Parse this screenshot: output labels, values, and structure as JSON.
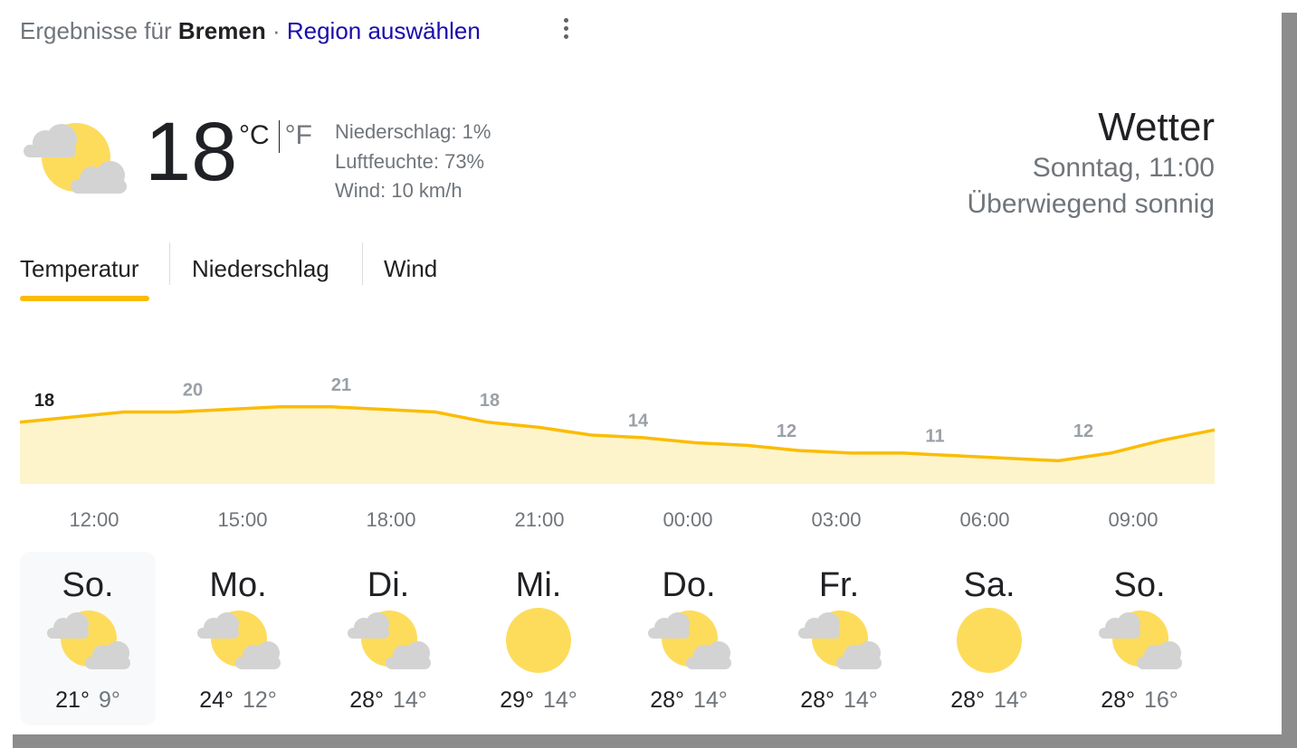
{
  "header": {
    "prefix": "Ergebnisse für",
    "location": "Bremen",
    "separator": "·",
    "region_link": "Region auswählen"
  },
  "current": {
    "icon": "partly-cloudy-icon",
    "temperature": "18",
    "unit_c": "°C",
    "unit_f": "°F",
    "precipitation": "Niederschlag: 1%",
    "humidity": "Luftfeuchte: 73%",
    "wind": "Wind: 10 km/h"
  },
  "summary": {
    "title": "Wetter",
    "datetime": "Sonntag, 11:00",
    "condition": "Überwiegend sonnig"
  },
  "tabs": [
    {
      "label": "Temperatur",
      "active": true
    },
    {
      "label": "Niederschlag",
      "active": false
    },
    {
      "label": "Wind",
      "active": false
    }
  ],
  "colors": {
    "accent": "#fbbc04",
    "area_fill": "#fdf4cc",
    "link": "#1a0dab",
    "muted": "#70757a",
    "sun": "#fddc5c",
    "cloud": "#d3d3d3"
  },
  "chart_data": {
    "type": "area",
    "categories": [
      "12:00",
      "15:00",
      "18:00",
      "21:00",
      "00:00",
      "03:00",
      "06:00",
      "09:00"
    ],
    "labels": [
      "18",
      "20",
      "21",
      "18",
      "14",
      "12",
      "11",
      "12"
    ],
    "values": [
      18,
      20,
      21,
      18,
      14,
      12,
      11,
      12
    ],
    "line": [
      18,
      19,
      20,
      20,
      20.5,
      21,
      21,
      20.5,
      20,
      18,
      17,
      15.5,
      15,
      14,
      13.5,
      12.5,
      12,
      12,
      11.5,
      11,
      10.5,
      12,
      14.5,
      16.5
    ],
    "ylim": [
      6,
      28
    ],
    "current_index": 0
  },
  "forecast": [
    {
      "day": "So.",
      "icon": "partly-cloudy-icon",
      "high": "21°",
      "low": "9°",
      "selected": true
    },
    {
      "day": "Mo.",
      "icon": "partly-cloudy-icon",
      "high": "24°",
      "low": "12°",
      "selected": false
    },
    {
      "day": "Di.",
      "icon": "partly-cloudy-icon",
      "high": "28°",
      "low": "14°",
      "selected": false
    },
    {
      "day": "Mi.",
      "icon": "sunny-icon",
      "high": "29°",
      "low": "14°",
      "selected": false
    },
    {
      "day": "Do.",
      "icon": "partly-cloudy-icon",
      "high": "28°",
      "low": "14°",
      "selected": false
    },
    {
      "day": "Fr.",
      "icon": "partly-cloudy-icon",
      "high": "28°",
      "low": "14°",
      "selected": false
    },
    {
      "day": "Sa.",
      "icon": "sunny-icon",
      "high": "28°",
      "low": "14°",
      "selected": false
    },
    {
      "day": "So.",
      "icon": "partly-cloudy-icon",
      "high": "28°",
      "low": "16°",
      "selected": false
    }
  ]
}
